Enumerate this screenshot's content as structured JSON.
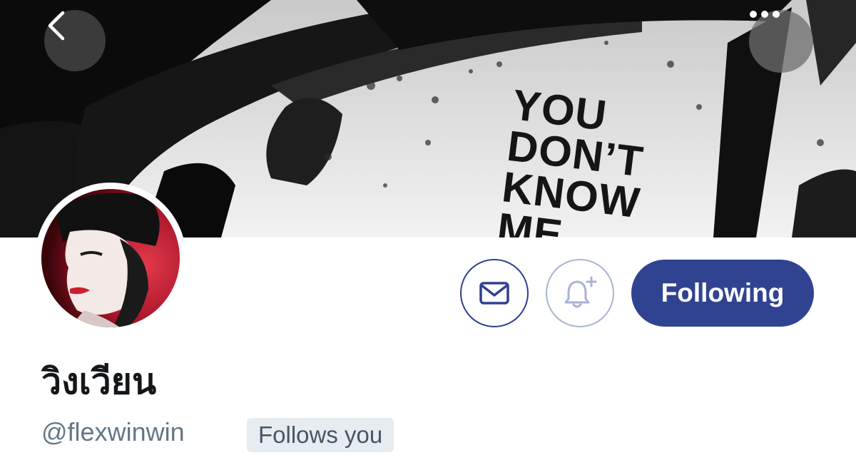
{
  "header": {
    "back_icon": "chevron-left-icon",
    "more_icon": "more-horizontal-icon",
    "banner_text": [
      "YOU",
      "DON’T",
      "KNOW",
      "ME"
    ]
  },
  "profile": {
    "display_name": "วิงเวียน",
    "handle": "@flexwinwin",
    "follows_you_badge": "Follows you"
  },
  "actions": {
    "message_icon": "envelope-icon",
    "notify_icon": "bell-plus-icon",
    "following_label": "Following"
  },
  "colors": {
    "accent": "#2f4391",
    "badge_bg": "#e6ecf0",
    "handle_text": "#657786",
    "name_text": "#14171a"
  }
}
